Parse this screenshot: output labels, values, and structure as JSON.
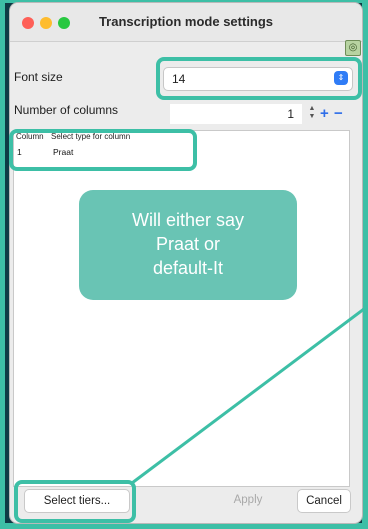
{
  "window": {
    "title": "Transcription mode settings"
  },
  "font_size": {
    "label": "Font size",
    "value": "14"
  },
  "num_columns": {
    "label": "Number of columns",
    "value": "1"
  },
  "table": {
    "headers": [
      "Column",
      "Select type for column"
    ],
    "rows": [
      {
        "column": "1",
        "type": "Praat"
      }
    ]
  },
  "callout": {
    "lines": [
      "Will either say",
      "Praat or",
      "default-It"
    ]
  },
  "buttons": {
    "select_tiers": "Select tiers...",
    "apply": "Apply",
    "cancel": "Cancel"
  },
  "colors": {
    "accent": "#3dbfa6",
    "callout": "#69c4b4",
    "background": "#0d3b45"
  }
}
